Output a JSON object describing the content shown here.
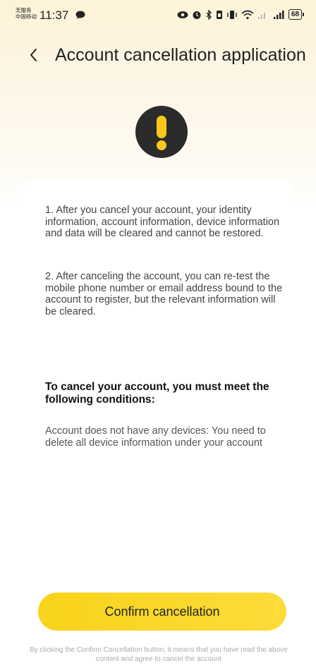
{
  "status_bar": {
    "carrier_line1": "无服务",
    "carrier_line2": "中国移动",
    "time": "11:37",
    "battery": "68"
  },
  "header": {
    "title": "Account cancellation application"
  },
  "notice": {
    "para1": "1. After you cancel your account, your identity information, account information, device information and data will be cleared and cannot be restored.",
    "para2": "2. After canceling the account, you can re-test the mobile phone number or email address bound to the account to register, but the relevant information will be cleared."
  },
  "conditions": {
    "title": "To cancel your account, you must meet the following conditions:",
    "text": "Account does not have any devices: You need to delete all device information under your account"
  },
  "actions": {
    "confirm_label": "Confirm cancellation",
    "footer_note": "By clicking the Confirm Cancellation button, it means that you have read the above content and agree to cancel the account"
  },
  "colors": {
    "accent": "#f9d523",
    "warning_bg": "#2b2b2b",
    "warning_mark": "#f6c81a"
  },
  "icons": [
    "back-arrow-icon",
    "warning-icon",
    "eye-icon",
    "alarm-icon",
    "bluetooth-icon",
    "vibrate-icon",
    "wifi-icon",
    "signal-icon",
    "battery-icon"
  ]
}
